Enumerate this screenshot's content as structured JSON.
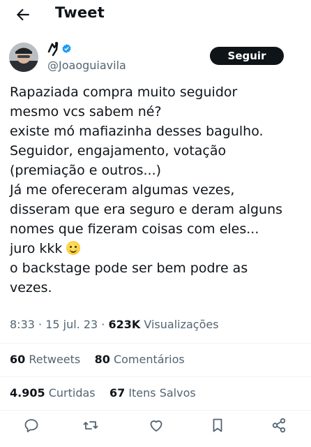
{
  "header": {
    "title": "Tweet",
    "back_icon": "arrow-left-icon"
  },
  "author": {
    "display_name_icon": "stylized-figure-icon",
    "verified_icon": "verified-badge-icon",
    "verified_color": "#1d9bf0",
    "handle": "@Joaoguiavila",
    "follow_label": "Seguir"
  },
  "tweet": {
    "text": "Rapaziada compra muito seguidor\nmesmo vcs sabem né?\nexiste mó mafiazinha desses bagulho.\nSeguidor, engajamento, votação\n(premiação e outros...)\nJá me ofereceram algumas vezes,\ndisseram que era seguro e deram alguns\nnomes que fizeram coisas com eles...\njuro kkk",
    "emoji": "slightly-smiling-face",
    "text_after": "o backstage pode ser bem podre as\nvezes."
  },
  "meta": {
    "time": "8:33",
    "sep1": " · ",
    "date": "15 jul. 23",
    "sep2": " · ",
    "views_count": "623K",
    "views_label": "Visualizações"
  },
  "stats": {
    "retweets_count": "60",
    "retweets_label": "Retweets",
    "comments_count": "80",
    "comments_label": "Comentários",
    "likes_count": "4.905",
    "likes_label": "Curtidas",
    "saves_count": "67",
    "saves_label": "Itens Salvos"
  },
  "actions": [
    "reply-icon",
    "retweet-icon",
    "like-icon",
    "bookmark-icon",
    "share-icon"
  ],
  "colors": {
    "text": "#0f1419",
    "secondary": "#536471",
    "divider": "#eff3f4",
    "button": "#0f1419"
  }
}
